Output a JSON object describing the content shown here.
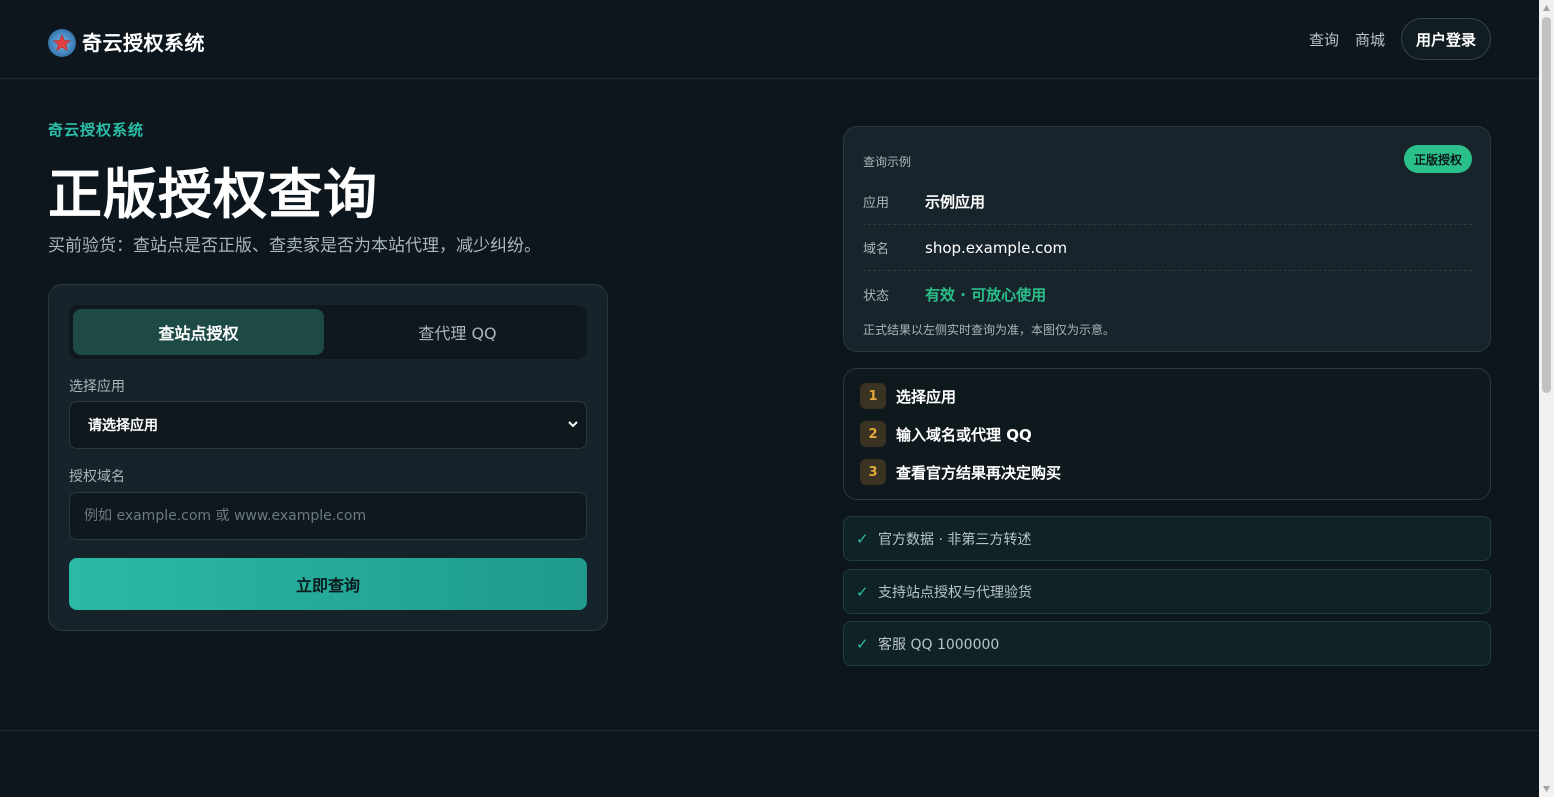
{
  "header": {
    "logo_text": "奇云授权系统",
    "nav": {
      "query": "查询",
      "shop": "商城",
      "login": "用户登录"
    }
  },
  "hero": {
    "eyebrow": "奇云授权系统",
    "title": "正版授权查询",
    "subtitle": "买前验货：查站点是否正版、查卖家是否为本站代理，减少纠纷。"
  },
  "form": {
    "tabs": [
      "查站点授权",
      "查代理 QQ"
    ],
    "active_tab": 0,
    "app_label": "选择应用",
    "app_select_value": "请选择应用",
    "domain_label": "授权域名",
    "domain_placeholder": "例如 example.com 或 www.example.com",
    "domain_value": "",
    "submit_label": "立即查询"
  },
  "example": {
    "heading": "查询示例",
    "badge": "正版授权",
    "rows": [
      {
        "key": "应用",
        "value": "示例应用"
      },
      {
        "key": "域名",
        "value": "shop.example.com"
      },
      {
        "key": "状态",
        "value": "有效 · 可放心使用"
      }
    ],
    "note": "正式结果以左侧实时查询为准，本图仅为示意。"
  },
  "steps": [
    {
      "num": "1",
      "text": "选择应用"
    },
    {
      "num": "2",
      "text": "输入域名或代理 QQ"
    },
    {
      "num": "3",
      "text": "查看官方结果再决定购买"
    }
  ],
  "features": [
    {
      "check": "✓",
      "text": "官方数据 · 非第三方转述"
    },
    {
      "check": "✓",
      "text": "支持站点授权与代理验货"
    },
    {
      "check": "✓",
      "text": "客服 QQ 1000000"
    }
  ],
  "colors": {
    "background": "#0c161c",
    "accent": "#2bbfa8",
    "badge_green": "#2bc08a",
    "step_orange": "#e4a93a"
  }
}
